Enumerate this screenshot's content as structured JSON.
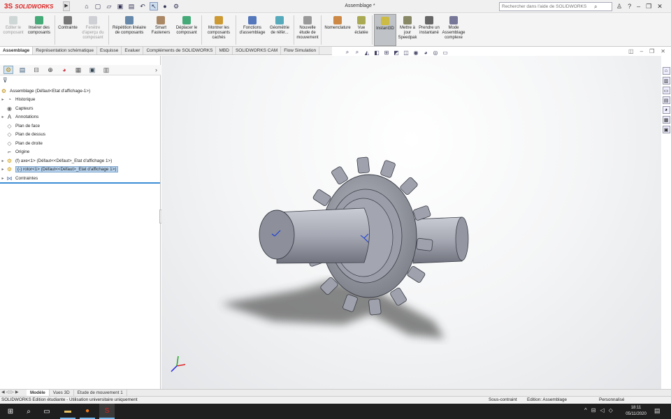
{
  "app": {
    "logo_ds": "3S",
    "logo_text": "SOLIDWORKS",
    "doc_title": "Assemblage *",
    "search_placeholder": "Rechercher dans l'aide de SOLIDWORKS",
    "quick_icons": [
      "home-icon",
      "new-doc-icon",
      "open-icon",
      "save-icon",
      "print-icon",
      "undo-icon",
      "select-icon",
      "rebuild-icon",
      "options-icon"
    ],
    "help_glyph": "?"
  },
  "ribbon": {
    "buttons": [
      {
        "name": "edit-component",
        "label": "Editer le composant",
        "disabled": true,
        "color": "#9aa"
      },
      {
        "name": "insert-components",
        "label": "Insérer des composants",
        "disabled": false,
        "color": "#4a7"
      },
      {
        "name": "mate",
        "label": "Contrainte",
        "disabled": false,
        "color": "#777"
      },
      {
        "name": "component-preview",
        "label": "Fenêtre d'aperçu du composant",
        "disabled": true,
        "color": "#99a"
      },
      {
        "name": "linear-pattern",
        "label": "Répétition linéaire de composants",
        "disabled": false,
        "color": "#68a"
      },
      {
        "name": "smart-fasteners",
        "label": "Smart Fasteners",
        "disabled": false,
        "color": "#a86"
      },
      {
        "name": "move-component",
        "label": "Déplacer le composant",
        "disabled": false,
        "color": "#4a7"
      },
      {
        "name": "show-hidden",
        "label": "Montrer les composants cachés",
        "disabled": false,
        "color": "#c93"
      },
      {
        "name": "assembly-features",
        "label": "Fonctions d'assemblage",
        "disabled": false,
        "color": "#57b"
      },
      {
        "name": "reference-geometry",
        "label": "Géométrie de référ...",
        "disabled": false,
        "color": "#5ab"
      },
      {
        "name": "new-motion-study",
        "label": "Nouvelle étude de mouvement",
        "disabled": false,
        "color": "#999"
      },
      {
        "name": "bill-of-materials",
        "label": "Nomenclature",
        "disabled": false,
        "color": "#c84"
      },
      {
        "name": "exploded-view",
        "label": "Vue éclatée",
        "disabled": false,
        "color": "#aa5"
      },
      {
        "name": "instant3d",
        "label": "Instant3D",
        "disabled": false,
        "active": true,
        "color": "#cb4"
      },
      {
        "name": "update-speedpak",
        "label": "Mettre à jour Speedpak",
        "disabled": false,
        "color": "#886"
      },
      {
        "name": "take-snapshot",
        "label": "Prendre un instantané",
        "disabled": false,
        "color": "#666"
      },
      {
        "name": "large-assembly-mode",
        "label": "Mode Assemblage complexe",
        "disabled": false,
        "color": "#779"
      }
    ]
  },
  "command_tabs": [
    "Assemblage",
    "Représentation schématique",
    "Esquisse",
    "Evaluer",
    "Compléments de SOLIDWORKS",
    "MBD",
    "SOLIDWORKS CAM",
    "Flow Simulation"
  ],
  "feature_tree": {
    "root": "Assemblage  (Défaut<Etat d'affichage-1>)",
    "items": [
      {
        "label": "Historique",
        "icon": "history-icon",
        "expand": "▸"
      },
      {
        "label": "Capteurs",
        "icon": "sensors-icon",
        "expand": ""
      },
      {
        "label": "Annotations",
        "icon": "annotations-icon",
        "expand": "▸"
      },
      {
        "label": "Plan de face",
        "icon": "plane-icon",
        "expand": ""
      },
      {
        "label": "Plan de dessus",
        "icon": "plane-icon",
        "expand": ""
      },
      {
        "label": "Plan de droite",
        "icon": "plane-icon",
        "expand": ""
      },
      {
        "label": "Origine",
        "icon": "origin-icon",
        "expand": ""
      },
      {
        "label": "(f) axe<1> (Défaut<<Défaut>_Etat d'affichage 1>)",
        "icon": "part-icon",
        "expand": "▸"
      },
      {
        "label": "(-) rotor<1> (Défaut<<Défaut>_Etat d'affichage 1>)",
        "icon": "part-icon",
        "expand": "▸",
        "selected": true
      },
      {
        "label": "Contraintes",
        "icon": "mates-icon",
        "expand": "▸"
      }
    ]
  },
  "bottom_tabs": [
    "Modèle",
    "Vues 3D",
    "Etude de mouvement 1"
  ],
  "status": {
    "left": "SOLIDWORKS Edition étudiante - Utilisation universitaire uniquement",
    "constraint": "Sous-contraint",
    "edit_mode": "Edition: Assemblage",
    "units": "Personnalisé"
  },
  "taskbar": {
    "time": "18:11",
    "date": "05/11/2020"
  },
  "colors": {
    "accent": "#3b8dd6",
    "part_face": "#a9acb5",
    "part_dark": "#6d707a",
    "selection": "#b9d4ee"
  }
}
